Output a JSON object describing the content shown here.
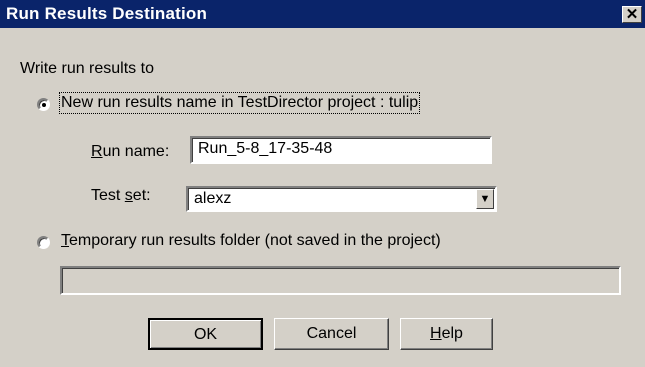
{
  "window": {
    "title": "Run Results Destination",
    "close_glyph": "✕"
  },
  "group_label": "Write run results to",
  "option_project": {
    "label": "New run results name in TestDirector project : tulip",
    "selected": true
  },
  "run_name": {
    "label_mnemonic": "R",
    "label_rest": "un name:",
    "value": "Run_5-8_17-35-48"
  },
  "test_set": {
    "label_prefix": "Test ",
    "label_mnemonic": "s",
    "label_rest": "et:",
    "value": "alexz",
    "arrow_glyph": "▼"
  },
  "option_temp": {
    "label_mnemonic": "T",
    "label_rest": "emporary run results folder (not saved in the project)",
    "selected": false,
    "folder_value": ""
  },
  "buttons": {
    "ok_label": "OK",
    "cancel_label": "Cancel",
    "help_mnemonic": "H",
    "help_rest": "elp"
  }
}
